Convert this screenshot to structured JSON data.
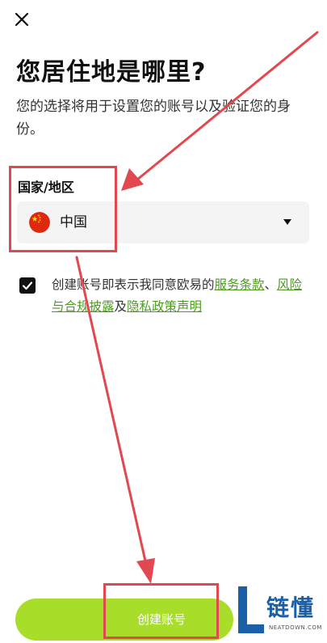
{
  "header": {
    "close_icon": "close-icon"
  },
  "title": "您居住地是哪里?",
  "subtitle": "您的选择将用于设置您的账号以及验证您的身份。",
  "country_field": {
    "label": "国家/地区",
    "selected": "中国",
    "flag_icon": "china-flag-icon",
    "dropdown_icon": "caret-down-icon"
  },
  "consent": {
    "checked": true,
    "text_before": "创建账号即表示我同意欧易的",
    "link_terms": "服务条款",
    "sep": "、",
    "link_risk": "风险与合规披露",
    "and": "及",
    "link_privacy": "隐私政策声明"
  },
  "create_button": {
    "label": "创建账号"
  },
  "watermark": {
    "cn": "链懂",
    "en": "NEATDOWN.COM"
  },
  "colors": {
    "accent": "#a8de2a",
    "link": "#4c9b1e",
    "annotation": "#e2484f"
  }
}
